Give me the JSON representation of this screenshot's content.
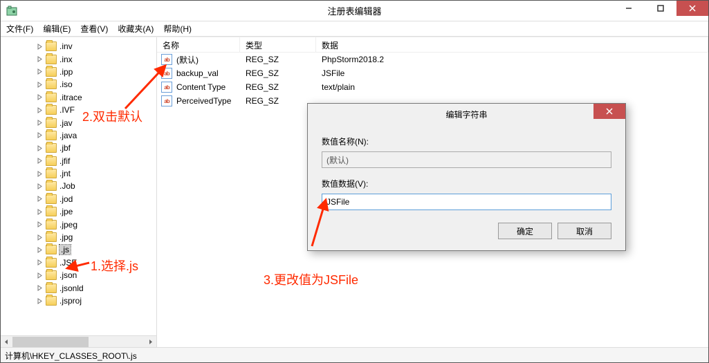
{
  "window": {
    "title": "注册表编辑器"
  },
  "menu": {
    "file": "文件(F)",
    "edit": "编辑(E)",
    "view": "查看(V)",
    "favorites": "收藏夹(A)",
    "help": "帮助(H)"
  },
  "tree": {
    "items": [
      {
        "label": ".inv"
      },
      {
        "label": ".inx"
      },
      {
        "label": ".ipp"
      },
      {
        "label": ".iso"
      },
      {
        "label": ".itrace"
      },
      {
        "label": ".IVF"
      },
      {
        "label": ".jav"
      },
      {
        "label": ".java"
      },
      {
        "label": ".jbf"
      },
      {
        "label": ".jfif"
      },
      {
        "label": ".jnt"
      },
      {
        "label": ".Job"
      },
      {
        "label": ".jod"
      },
      {
        "label": ".jpe"
      },
      {
        "label": ".jpeg"
      },
      {
        "label": ".jpg"
      },
      {
        "label": ".js",
        "selected": true
      },
      {
        "label": ".JSE"
      },
      {
        "label": ".json"
      },
      {
        "label": ".jsonld"
      },
      {
        "label": ".jsproj"
      }
    ]
  },
  "list": {
    "headers": {
      "name": "名称",
      "type": "类型",
      "data": "数据"
    },
    "rows": [
      {
        "name": "(默认)",
        "type": "REG_SZ",
        "data": "PhpStorm2018.2"
      },
      {
        "name": "backup_val",
        "type": "REG_SZ",
        "data": "JSFile"
      },
      {
        "name": "Content Type",
        "type": "REG_SZ",
        "data": "text/plain"
      },
      {
        "name": "PerceivedType",
        "type": "REG_SZ",
        "data": ""
      }
    ]
  },
  "dialog": {
    "title": "编辑字符串",
    "name_label": "数值名称(N):",
    "name_value": "(默认)",
    "data_label": "数值数据(V):",
    "data_value": "JSFile",
    "ok": "确定",
    "cancel": "取消"
  },
  "statusbar": "计算机\\HKEY_CLASSES_ROOT\\.js",
  "annotations": {
    "a1": "1.选择.js",
    "a2": "2.双击默认",
    "a3": "3.更改值为JSFile"
  }
}
